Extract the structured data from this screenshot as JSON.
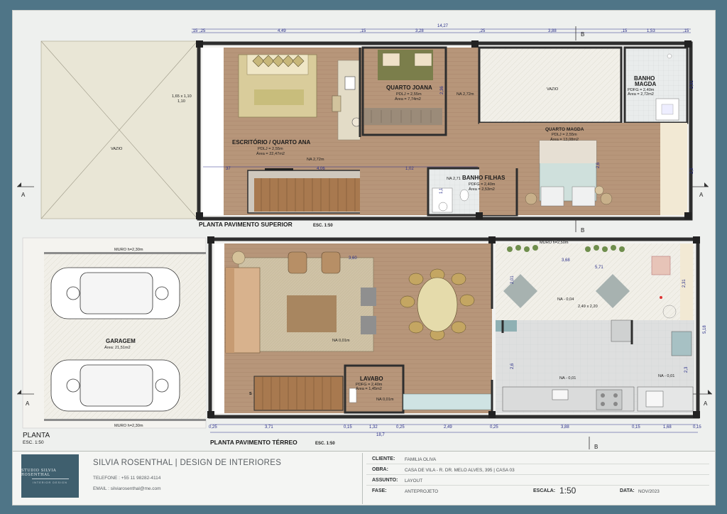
{
  "plans": {
    "upper_title": "PLANTA PAVIMENTO SUPERIOR",
    "upper_scale": "ESC. 1:50",
    "ground_title": "PLANTA PAVIMENTO TÉRREO",
    "ground_scale": "ESC. 1:50",
    "site_title": "PLANTA",
    "site_scale": "ESC. 1:50",
    "void_label": "VAZIO",
    "void_label_2": "VAZIO",
    "window_spec": "1,65 x 1,10",
    "window_spec_2": "1,10"
  },
  "rooms": {
    "escritorio": {
      "name": "ESCRITÓRIO / QUARTO ANA",
      "pd": "PDLJ = 2,55m",
      "area": "Área = 22,47m2",
      "na": "NA 2,72m"
    },
    "joana": {
      "name": "QUARTO JOANA",
      "pd": "PDLJ = 2,55m",
      "area": "Área = 7,74m2",
      "na": "NA 2,72m"
    },
    "magda": {
      "name": "QUARTO MAGDA",
      "pd": "PDLJ = 2,55m",
      "area": "Área = 13,08m2"
    },
    "banho_magda": {
      "name1": "BANHO",
      "name2": "MAGDA",
      "pd": "PDFG = 2,40m",
      "area": "Área = 2,72m2"
    },
    "banho_filhas": {
      "name": "BANHO FILHAS",
      "pd": "PDFG = 2,40m",
      "area": "Área = 2,53m2",
      "na": "NA 2,71"
    },
    "garagem": {
      "name": "GARAGEM",
      "area": "Área: 21,51m2"
    },
    "lavabo": {
      "name": "LAVABO",
      "pd": "PDFG = 2,40m",
      "area": "Área = 1,45m2",
      "na": "NA 0,01m"
    },
    "living_na": "NA 0,01m",
    "terrace_na": "NA - 0,04",
    "terrace_dim": "2,49 x 2,20",
    "kitchen_na_1": "NA - 0,01",
    "kitchen_na_2": "NA - 0,01"
  },
  "walls": {
    "muro_top": "MURO h=2,30m",
    "muro_bottom": "MURO h=2,30m",
    "muro_terrace": "MURO h=2,50m"
  },
  "section_marks": {
    "a": "A",
    "b": "B"
  },
  "stair_marks": {
    "upper": "D",
    "ground": "S"
  },
  "dims": {
    "upper_total": "14,27",
    "upper_1": "4,49",
    "upper_2": "3,28",
    "upper_3": "3,88",
    "upper_4": "1,53",
    "upper_s1": ",15",
    "upper_s2": ",25",
    "upper_s3": ",15",
    "upper_s4": ",25",
    "upper_s5": ",15",
    "upper_s6": ",15",
    "upper_right_1": "2,31",
    "upper_right_2": "2,3",
    "upper_mid_1": "4,06",
    "upper_mid_2": "1,02",
    "upper_mid_3": "37",
    "upper_v1": "2,36",
    "upper_v2": "2,6",
    "upper_v3": "1,1",
    "ground_total": "18,7",
    "ground_1": "3,71",
    "ground_2": "1,32",
    "ground_3": "2,49",
    "ground_4": "3,88",
    "ground_5": "1,68",
    "ground_s1": "0,25",
    "ground_s2": "0,15",
    "ground_s3": "0,25",
    "ground_s4": "0,25",
    "ground_s5": "0,15",
    "ground_s6": "0,15",
    "ground_top_1": "3,68",
    "ground_top_2": "5,71",
    "ground_top_3": "3,60",
    "ground_right_1": "5,18",
    "ground_right_2": "2,31",
    "ground_v1": "2,01",
    "ground_v2": "2,6",
    "ground_v3": "2,3"
  },
  "titleblock": {
    "logo_line1": "STUDIO SILVIA ROSENTHAL",
    "logo_line2": "INTERIOR DESIGN",
    "studio_name": "SILVIA ROSENTHAL | DESIGN DE INTERIORES",
    "phone": "TELEFONE : +55 11 98282-4114",
    "email": "EMAIL : silviarosenthal@me.com",
    "cliente_key": "CLIENTE:",
    "cliente_val": "FAMILIA OLIVA",
    "obra_key": "OBRA:",
    "obra_val": "CASA DE VILA - R. DR. MELO ALVES, 395 | CASA 03",
    "assunto_key": "ASSUNTO:",
    "assunto_val": "LAYOUT",
    "fase_key": "FASE:",
    "fase_val": "ANTEPROJETO",
    "escala_key": "ESCALA:",
    "escala_val": "1:50",
    "data_key": "DATA:",
    "data_val": "NOV/2023"
  },
  "colors": {
    "background": "#4f7587",
    "sheet": "#eef0ee",
    "wood_floor": "#b7967a",
    "wall": "#3a3a3a",
    "dimension": "#2a2f8a",
    "logo": "#3f5f6e"
  }
}
